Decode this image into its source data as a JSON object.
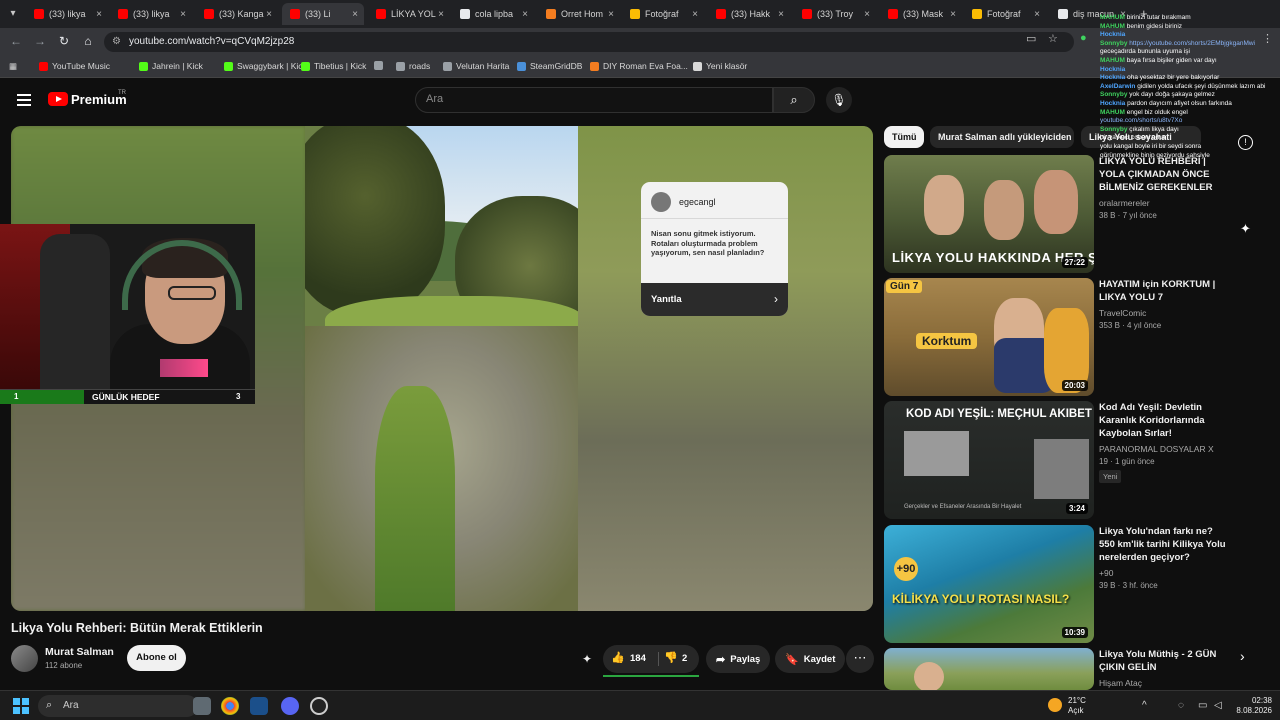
{
  "browser": {
    "tabs": [
      {
        "label": "(33) likya",
        "color": "#ff0000"
      },
      {
        "label": "(33) likya",
        "color": "#ff0000"
      },
      {
        "label": "(33) Kanga",
        "color": "#ff0000"
      },
      {
        "label": "(33) Li",
        "color": "#ff0000",
        "active": true
      },
      {
        "label": "LİKYA YOL",
        "color": "#ff0000"
      },
      {
        "label": "cola lipba",
        "color": "#e8eaed"
      },
      {
        "label": "Orret Hom",
        "color": "#f47d20"
      },
      {
        "label": "Fotoğraf",
        "color": "#fbbc04"
      },
      {
        "label": "(33) Hakk",
        "color": "#ff0000"
      },
      {
        "label": "(33) Troy",
        "color": "#ff0000"
      },
      {
        "label": "(33) Mask",
        "color": "#ff0000"
      },
      {
        "label": "Fotoğraf",
        "color": "#fbbc04"
      },
      {
        "label": "diş macun",
        "color": "#e8eaed"
      }
    ],
    "url": "youtube.com/watch?v=qCVqM2jzp28",
    "bookmarks": [
      {
        "label": "YouTube Music",
        "color": "#ff0000"
      },
      {
        "label": "Jahrein | Kick",
        "color": "#53fc18"
      },
      {
        "label": "Swaggybark | Kick",
        "color": "#53fc18"
      },
      {
        "label": "Tibetius | Kick",
        "color": "#53fc18"
      },
      {
        "label": "",
        "color": "#9aa0a6"
      },
      {
        "label": "roads",
        "color": "#9aa0a6"
      },
      {
        "label": "Velutan Harita",
        "color": "#9aa0a6"
      },
      {
        "label": "SteamGridDB",
        "color": "#4a90d9"
      },
      {
        "label": "DIY Roman Eva Foa...",
        "color": "#f47d20"
      },
      {
        "label": "Yeni klasör",
        "color": "#d8d8d8"
      }
    ]
  },
  "youtube": {
    "brand": "Premium",
    "region": "TR",
    "search_placeholder": "Ara"
  },
  "player": {
    "popup": {
      "username": "egecangl",
      "message": "Nisan sonu gitmek istiyorum. Rotaları oluşturmada problem yaşıyorum, sen nasıl planladın?",
      "reply_label": "Yanıtla"
    },
    "goal": {
      "current": "1",
      "title": "GÜNLÜK HEDEF",
      "target": "3",
      "progress": 0.33
    }
  },
  "video": {
    "title": "Likya Yolu Rehberi: Bütün Merak Ettiklerin",
    "channel": "Murat Salman",
    "subscribers": "112 abone",
    "subscribe_label": "Abone ol",
    "likes": "184",
    "dislikes": "2",
    "share_label": "Paylaş",
    "save_label": "Kaydet"
  },
  "sidebar": {
    "chips": [
      "Tümü",
      "Murat Salman adlı yükleyiciden",
      "Likya Yolu seyahati"
    ],
    "recommendations": [
      {
        "title": "LİKYA YOLU REHBERİ | YOLA ÇIKMADAN ÖNCE BİLMENİZ GEREKENLER",
        "channel": "oralarmereler",
        "meta": "38 B · 7 yıl önce",
        "duration": "27:22",
        "thumb_text": "LİKYA YOLU HAKKINDA HER ŞEY"
      },
      {
        "title": "HAYATIM için KORKTUM | LIKYA YOLU 7",
        "channel": "TravelComic",
        "meta": "353 B · 4 yıl önce",
        "duration": "20:03",
        "thumb_text": "Korktum",
        "thumb_tag": "Gün 7"
      },
      {
        "title": "Kod Adı Yeşil: Devletin Karanlık Koridorlarında Kaybolan Sırlar!",
        "channel": "PARANORMAL DOSYALAR X",
        "meta": "19 · 1 gün önce",
        "badge": "Yeni",
        "duration": "3:24",
        "thumb_text": "KOD ADI YEŞİL: MEÇHUL AKIBET",
        "thumb_sub": "Gerçekler ve Efsaneler Arasında Bir Hayalet"
      },
      {
        "title": "Likya Yolu'ndan farkı ne? 550 km'lik tarihi Kilikya Yolu nerelerden geçiyor?",
        "channel": "+90",
        "meta": "39 B · 3 hf. önce",
        "duration": "10:39",
        "thumb_text": "KİLİKYA YOLU ROTASI NASIL?"
      },
      {
        "title": "Likya Yolu Müthiş - 2 GÜN ÇIKIN GELİN",
        "channel": "Hişam Ataç",
        "meta": "",
        "duration": ""
      }
    ]
  },
  "chat": [
    {
      "user": "MAHUM",
      "msg": "birinizi tutar bırakmam",
      "ucolor": "#3fd35f"
    },
    {
      "user": "MAHUM",
      "msg": "benim gidesi biriniz",
      "ucolor": "#3fd35f"
    },
    {
      "user": "Hocknia",
      "msg": "",
      "ucolor": "#4fa6ff"
    },
    {
      "user": "Sonnyby",
      "msg": "https://youtube.com/shorts/2EMbjgkganMwi",
      "ucolor": "#3fd35f",
      "link": true
    },
    {
      "user": "",
      "msg": "geceçadırda bununla uyuma işi",
      "ucolor": "#3fd35f"
    },
    {
      "user": "MAHUM",
      "msg": "baya fırsa bişiler giden var dayı",
      "ucolor": "#3fd35f"
    },
    {
      "user": "Hocknia",
      "msg": "",
      "ucolor": "#4fa6ff"
    },
    {
      "user": "Hocknia",
      "msg": "oha yesektaz bir yere bakıyorlar",
      "ucolor": "#4fa6ff"
    },
    {
      "user": "AxelDarwin",
      "msg": "gidilen yolda ufacık şeyi düşünmek lazım abi",
      "ucolor": "#4fa6ff"
    },
    {
      "user": "Sonnyby",
      "msg": "yok dayı doğa şakaya gelmez",
      "ucolor": "#3fd35f"
    },
    {
      "user": "Hocknia",
      "msg": "pardon dayıcım afiyet olsun farkında",
      "ucolor": "#4fa6ff"
    },
    {
      "user": "MAHUM",
      "msg": "engel biz olduk engel",
      "ucolor": "#3fd35f"
    },
    {
      "user": "",
      "msg": "youtube.com/shorts/u8tv7Xo",
      "ucolor": "#3fd35f",
      "link": true
    },
    {
      "user": "Sonnyby",
      "msg": "çıkalım likya dayı",
      "ucolor": "#3fd35f"
    },
    {
      "user": "",
      "msg": "bir ya keci cobani onun",
      "ucolor": "#3fd35f"
    },
    {
      "user": "",
      "msg": "yolu kangal boyle iri bir seydi sonra",
      "ucolor": "#3fd35f"
    },
    {
      "user": "",
      "msg": "görünmekline binip geziyordu şahsiyle",
      "ucolor": "#3fd35f"
    }
  ],
  "taskbar": {
    "search": "Ara",
    "weather_temp": "21°C",
    "weather_desc": "Açık",
    "time": "02:38",
    "date": "8.08.2026"
  }
}
